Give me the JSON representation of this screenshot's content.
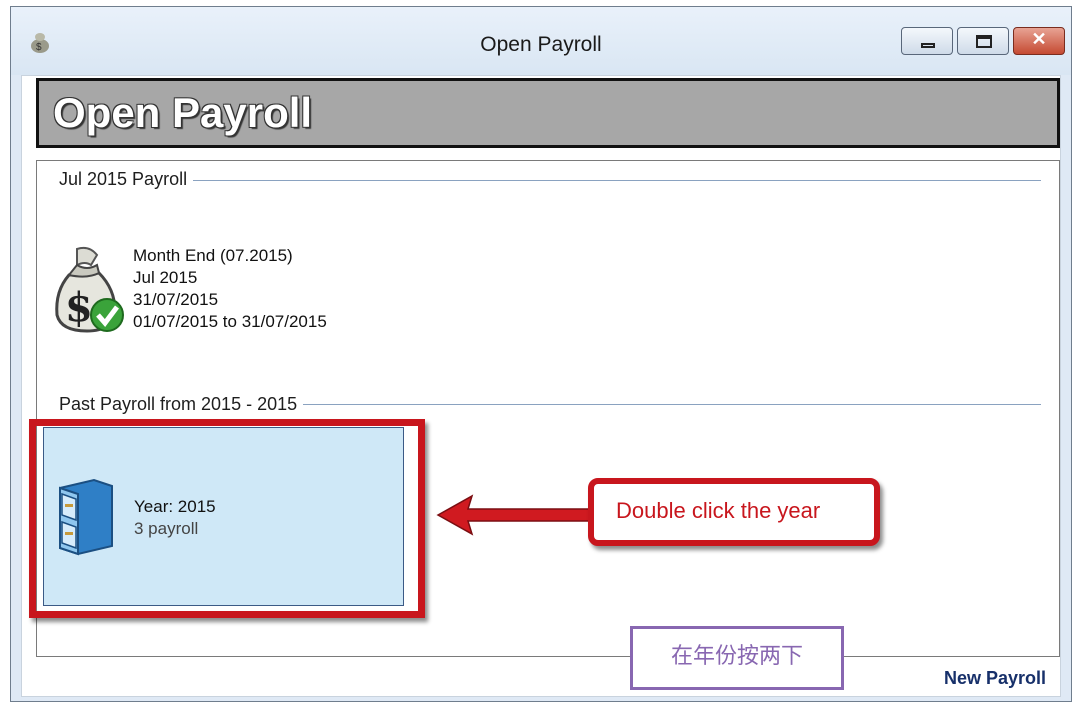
{
  "window": {
    "title": "Open Payroll",
    "controls": {
      "minimize": "minimize",
      "maximize": "maximize",
      "close": "✕"
    }
  },
  "header": {
    "title": "Open Payroll"
  },
  "current_section": {
    "label": "Jul 2015 Payroll",
    "item": {
      "name": "Month End (07.2015)",
      "period": "Jul 2015",
      "date": "31/07/2015",
      "range": "01/07/2015 to 31/07/2015",
      "icon": "money-bag-check-icon"
    }
  },
  "past_section": {
    "label": "Past Payroll from 2015 - 2015",
    "item": {
      "year_label": "Year: 2015",
      "count": "3 payroll",
      "icon": "file-cabinet-icon"
    }
  },
  "annotations": {
    "callout": "Double click the year",
    "chinese_note": "在年份按两下"
  },
  "footer": {
    "new_payroll": "New Payroll"
  },
  "colors": {
    "annotation_red": "#c8161d",
    "tile_blue": "#cfe8f7",
    "note_purple": "#8867b1",
    "link_navy": "#17306a"
  }
}
